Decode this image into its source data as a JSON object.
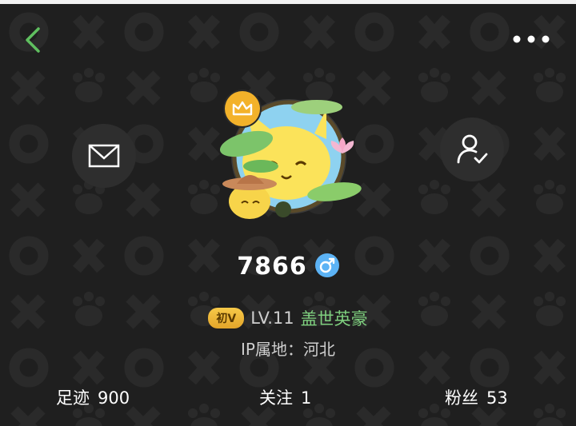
{
  "header": {
    "back_icon": "chevron-left-icon",
    "more_icon": "ellipsis-icon"
  },
  "actions": {
    "message_icon": "envelope-icon",
    "follow_icon": "user-check-icon"
  },
  "profile": {
    "username": "7866",
    "gender": "male",
    "vip_badge": "初V",
    "level": "LV.11",
    "title": "盖世英豪",
    "ip_location": "IP属地：河北"
  },
  "stats": {
    "footprint_label": "足迹",
    "footprint_value": "900",
    "following_label": "关注",
    "following_value": "1",
    "fans_label": "粉丝",
    "fans_value": "53"
  },
  "colors": {
    "background": "#1f1f1f",
    "accent_green": "#5fbf5f",
    "title_green": "#7fd07f",
    "crown_gold": "#f3b22a",
    "gender_blue": "#5cb3f5"
  }
}
